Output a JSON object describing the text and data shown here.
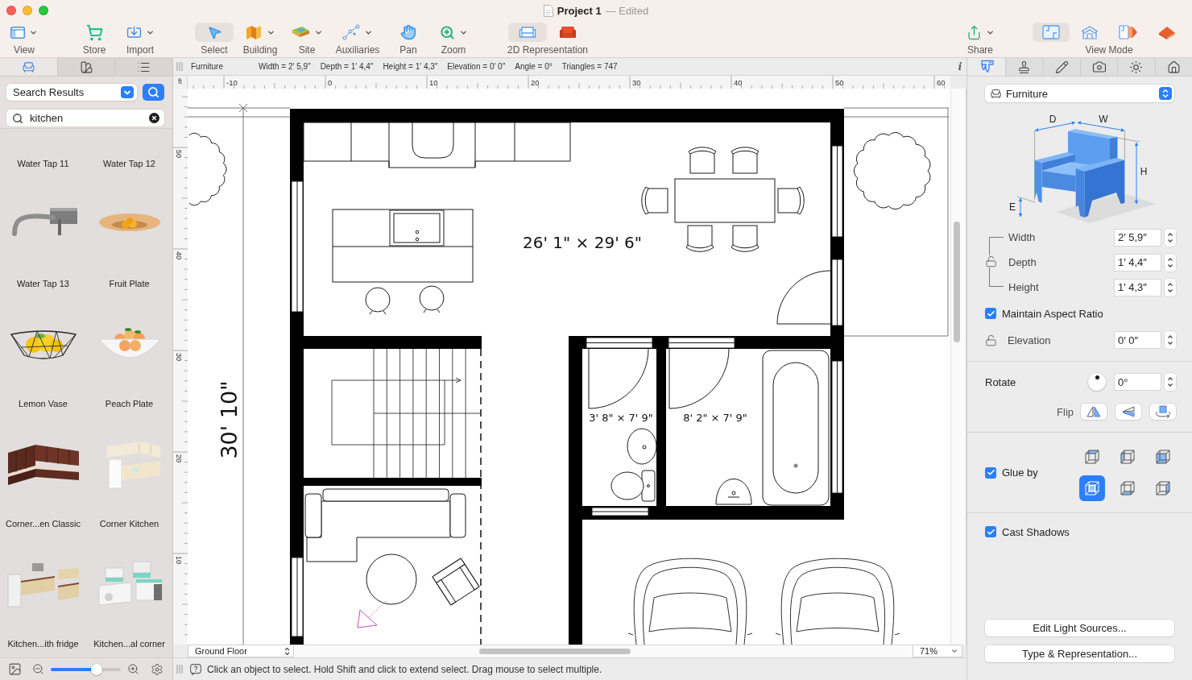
{
  "window": {
    "title": "Project 1",
    "status": "— Edited"
  },
  "toolbar": {
    "items": [
      {
        "label": "View",
        "kind": "view",
        "dropdown": true,
        "selected": false
      },
      {
        "label": "Store",
        "kind": "store",
        "dropdown": false,
        "selected": false
      },
      {
        "label": "Import",
        "kind": "import",
        "dropdown": true,
        "selected": false
      },
      {
        "label": "Select",
        "kind": "select",
        "dropdown": false,
        "selected": true
      },
      {
        "label": "Building",
        "kind": "building",
        "dropdown": true,
        "selected": false
      },
      {
        "label": "Site",
        "kind": "site",
        "dropdown": true,
        "selected": false
      },
      {
        "label": "Auxiliaries",
        "kind": "auxiliaries",
        "dropdown": true,
        "selected": false
      },
      {
        "label": "Pan",
        "kind": "pan",
        "dropdown": false,
        "selected": false
      },
      {
        "label": "Zoom",
        "kind": "zoom",
        "dropdown": true,
        "selected": false
      }
    ],
    "representation": {
      "label": "2D Representation",
      "options": [
        {
          "kind": "outline",
          "selected": true
        },
        {
          "kind": "filled",
          "selected": false
        }
      ]
    },
    "share": {
      "label": "Share",
      "dropdown": true
    },
    "view_mode": {
      "label": "View Mode",
      "options": [
        {
          "kind": "plan",
          "selected": true
        },
        {
          "kind": "elevation",
          "selected": false
        },
        {
          "kind": "split",
          "selected": false
        },
        {
          "kind": "perspective",
          "selected": false
        }
      ]
    }
  },
  "library": {
    "tabs": [
      {
        "kind": "furniture",
        "selected": true
      },
      {
        "kind": "materials",
        "selected": false
      },
      {
        "kind": "list",
        "selected": false
      }
    ],
    "source": "Search Results",
    "search": {
      "value": "kitchen"
    },
    "items": [
      {
        "label": "Water Tap 11"
      },
      {
        "label": "Water Tap 12"
      },
      {
        "label": "Water Tap 13",
        "kind": "faucet"
      },
      {
        "label": "Fruit Plate",
        "kind": "plate"
      },
      {
        "label": "Lemon Vase",
        "kind": "basket"
      },
      {
        "label": "Peach Plate",
        "kind": "bowl"
      },
      {
        "label": "Corner...en Classic",
        "kind": "cabinets"
      },
      {
        "label": "Corner Kitchen",
        "kind": "corner"
      },
      {
        "label": "Kitchen...ith fridge",
        "kind": "fridge"
      },
      {
        "label": "Kitchen...al corner",
        "kind": "modular"
      }
    ],
    "thumbnail_size": {
      "level": 0.66
    }
  },
  "info_bar": {
    "object": "Furniture",
    "fields": [
      "Width = 2′ 5,9″",
      "Depth = 1′ 4,4″",
      "Height = 1′ 4,3″",
      "Elevation = 0′ 0″",
      "Angle = 0°",
      "Triangles = 747"
    ],
    "info": "i"
  },
  "ruler": {
    "unit": "ft",
    "x_labels": [
      "-10",
      "0",
      "10",
      "20",
      "30",
      "40",
      "50",
      "60"
    ],
    "y_labels": [
      "50",
      "40",
      "30",
      "20",
      "10"
    ]
  },
  "plan": {
    "room_labels": [
      "26' 1\" × 29' 6\"",
      "3' 8\" × 7' 9\"",
      "8' 2\" × 7' 9\""
    ],
    "wall_dimension": "30' 10\""
  },
  "canvas_footer": {
    "level": "Ground Floor",
    "zoom": "71%"
  },
  "status_bar": {
    "message": "Click an object to select. Hold Shift and click to extend select. Drag mouse to select multiple."
  },
  "inspector": {
    "tabs": [
      {
        "kind": "calipers",
        "selected": true
      },
      {
        "kind": "stamp",
        "selected": false
      },
      {
        "kind": "pencil",
        "selected": false
      },
      {
        "kind": "camera",
        "selected": false
      },
      {
        "kind": "sun",
        "selected": false
      },
      {
        "kind": "house",
        "selected": false
      }
    ],
    "category": "Furniture",
    "diagram_labels": [
      "D",
      "W",
      "H",
      "E"
    ],
    "size_locked": false,
    "size_fields": [
      {
        "label": "Width",
        "value": "2′ 5,9″"
      },
      {
        "label": "Depth",
        "value": "1′ 4,4″"
      },
      {
        "label": "Height",
        "value": "1′ 4,3″"
      }
    ],
    "maintain_aspect_ratio": {
      "label": "Maintain Aspect Ratio",
      "checked": true
    },
    "elevation": {
      "label": "Elevation",
      "value": "0′ 0″",
      "locked": false
    },
    "rotate": {
      "label": "Rotate",
      "value": "0°"
    },
    "flip": {
      "label": "Flip",
      "options": [
        {
          "kind": "horizontal"
        },
        {
          "kind": "vertical"
        },
        {
          "kind": "spin"
        }
      ]
    },
    "glue": {
      "label": "Glue by",
      "checked": true,
      "options": [
        {
          "kind": "top",
          "selected": false
        },
        {
          "kind": "left",
          "selected": false
        },
        {
          "kind": "front",
          "selected": false
        },
        {
          "kind": "center",
          "selected": true
        },
        {
          "kind": "bottom",
          "selected": false
        },
        {
          "kind": "right",
          "selected": false
        }
      ]
    },
    "cast_shadows": {
      "label": "Cast Shadows",
      "checked": true
    },
    "buttons": [
      "Edit Light Sources...",
      "Type & Representation..."
    ]
  }
}
